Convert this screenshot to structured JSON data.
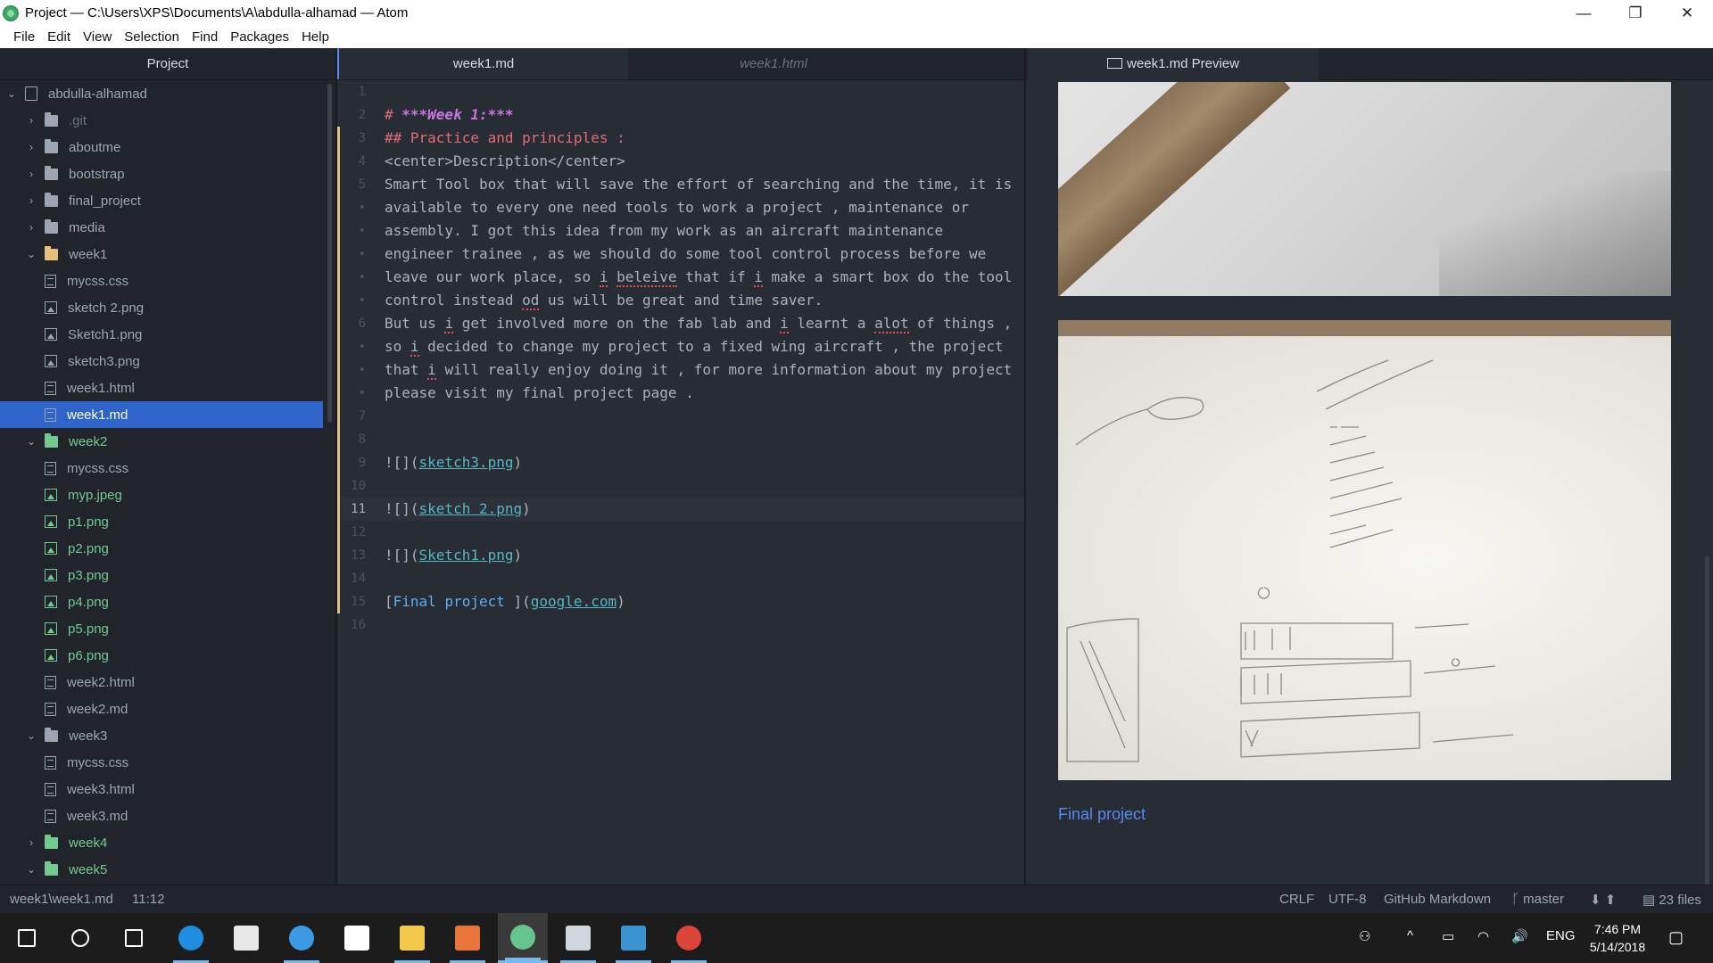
{
  "window": {
    "title": "Project — C:\\Users\\XPS\\Documents\\A\\abdulla-alhamad — Atom",
    "controls": {
      "minimize": "—",
      "maximize": "❐",
      "close": "✕"
    }
  },
  "menu": [
    "File",
    "Edit",
    "View",
    "Selection",
    "Find",
    "Packages",
    "Help"
  ],
  "tree": {
    "header": "Project",
    "rows": [
      {
        "label": "abdulla-alhamad",
        "arrow": "⌄",
        "icon": "repo",
        "indent": 0,
        "color": ""
      },
      {
        "label": ".git",
        "arrow": "›",
        "icon": "folder",
        "indent": 1,
        "color": "git"
      },
      {
        "label": "aboutme",
        "arrow": "›",
        "icon": "folder",
        "indent": 1,
        "color": ""
      },
      {
        "label": "bootstrap",
        "arrow": "›",
        "icon": "folder",
        "indent": 1,
        "color": ""
      },
      {
        "label": "final_project",
        "arrow": "›",
        "icon": "folder",
        "indent": 1,
        "color": ""
      },
      {
        "label": "media",
        "arrow": "›",
        "icon": "folder",
        "indent": 1,
        "color": ""
      },
      {
        "label": "week1",
        "arrow": "⌄",
        "icon": "folder-open",
        "indent": 1,
        "color": ""
      },
      {
        "label": "mycss.css",
        "arrow": "",
        "icon": "file",
        "indent": 2,
        "color": ""
      },
      {
        "label": "sketch 2.png",
        "arrow": "",
        "icon": "media",
        "indent": 2,
        "color": ""
      },
      {
        "label": "Sketch1.png",
        "arrow": "",
        "icon": "media",
        "indent": 2,
        "color": ""
      },
      {
        "label": "sketch3.png",
        "arrow": "",
        "icon": "media",
        "indent": 2,
        "color": ""
      },
      {
        "label": "week1.html",
        "arrow": "",
        "icon": "file",
        "indent": 2,
        "color": ""
      },
      {
        "label": "week1.md",
        "arrow": "",
        "icon": "file",
        "indent": 2,
        "color": "",
        "selected": true
      },
      {
        "label": "week2",
        "arrow": "⌄",
        "icon": "folder-green",
        "indent": 1,
        "color": "green"
      },
      {
        "label": "mycss.css",
        "arrow": "",
        "icon": "file",
        "indent": 2,
        "color": ""
      },
      {
        "label": "myp.jpeg",
        "arrow": "",
        "icon": "media-green",
        "indent": 2,
        "color": "green"
      },
      {
        "label": "p1.png",
        "arrow": "",
        "icon": "media-green",
        "indent": 2,
        "color": "green"
      },
      {
        "label": "p2.png",
        "arrow": "",
        "icon": "media-green",
        "indent": 2,
        "color": "green"
      },
      {
        "label": "p3.png",
        "arrow": "",
        "icon": "media-green",
        "indent": 2,
        "color": "green"
      },
      {
        "label": "p4.png",
        "arrow": "",
        "icon": "media-green",
        "indent": 2,
        "color": "green"
      },
      {
        "label": "p5.png",
        "arrow": "",
        "icon": "media-green",
        "indent": 2,
        "color": "green"
      },
      {
        "label": "p6.png",
        "arrow": "",
        "icon": "media-green",
        "indent": 2,
        "color": "green"
      },
      {
        "label": "week2.html",
        "arrow": "",
        "icon": "file",
        "indent": 2,
        "color": ""
      },
      {
        "label": "week2.md",
        "arrow": "",
        "icon": "file",
        "indent": 2,
        "color": ""
      },
      {
        "label": "week3",
        "arrow": "⌄",
        "icon": "folder",
        "indent": 1,
        "color": ""
      },
      {
        "label": "mycss.css",
        "arrow": "",
        "icon": "file",
        "indent": 2,
        "color": ""
      },
      {
        "label": "week3.html",
        "arrow": "",
        "icon": "file",
        "indent": 2,
        "color": ""
      },
      {
        "label": "week3.md",
        "arrow": "",
        "icon": "file",
        "indent": 2,
        "color": ""
      },
      {
        "label": "week4",
        "arrow": "›",
        "icon": "folder-green",
        "indent": 1,
        "color": "green"
      },
      {
        "label": "week5",
        "arrow": "⌄",
        "icon": "folder-green",
        "indent": 1,
        "color": "green"
      }
    ]
  },
  "editor": {
    "tabs": [
      "week1.md",
      "week1.html"
    ],
    "cursor_line": 11,
    "lines": [
      {
        "n": "1",
        "segs": []
      },
      {
        "n": "2",
        "segs": [
          {
            "t": "# ",
            "c": "md-h"
          },
          {
            "t": "***Week 1:***",
            "c": "md-em"
          }
        ]
      },
      {
        "n": "3",
        "segs": [
          {
            "t": "## Practice and principles :",
            "c": "md-h"
          }
        ]
      },
      {
        "n": "4",
        "segs": [
          {
            "t": "<center>Description</center>",
            "c": ""
          }
        ]
      },
      {
        "n": "5",
        "segs": [
          {
            "t": "Smart Tool box that will save the effort of searching and the time, it is",
            "c": ""
          }
        ]
      },
      {
        "n": "•",
        "segs": [
          {
            "t": "available to every one need tools to work a project , maintenance or",
            "c": ""
          }
        ]
      },
      {
        "n": "•",
        "segs": [
          {
            "t": "assembly. I got this idea from my work as an aircraft maintenance",
            "c": ""
          }
        ]
      },
      {
        "n": "•",
        "segs": [
          {
            "t": "engineer trainee , as we should do some tool control process before we",
            "c": ""
          }
        ]
      },
      {
        "n": "•",
        "segs": [
          {
            "t": "leave our work place, so ",
            "c": ""
          },
          {
            "t": "i",
            "c": "spell"
          },
          {
            "t": " ",
            "c": ""
          },
          {
            "t": "beleive",
            "c": "spell"
          },
          {
            "t": " that if ",
            "c": ""
          },
          {
            "t": "i",
            "c": "spell"
          },
          {
            "t": " make a smart box do the tool",
            "c": ""
          }
        ]
      },
      {
        "n": "•",
        "segs": [
          {
            "t": "control instead ",
            "c": ""
          },
          {
            "t": "od",
            "c": "spell"
          },
          {
            "t": " us will be great and time saver.",
            "c": ""
          }
        ]
      },
      {
        "n": "6",
        "segs": [
          {
            "t": "But us ",
            "c": ""
          },
          {
            "t": "i",
            "c": "spell"
          },
          {
            "t": " get involved more on the fab lab and ",
            "c": ""
          },
          {
            "t": "i",
            "c": "spell"
          },
          {
            "t": " learnt a ",
            "c": ""
          },
          {
            "t": "alot",
            "c": "spell"
          },
          {
            "t": " of things ,",
            "c": ""
          }
        ]
      },
      {
        "n": "•",
        "segs": [
          {
            "t": "so ",
            "c": ""
          },
          {
            "t": "i",
            "c": "spell"
          },
          {
            "t": " decided to change my project to a fixed wing aircraft , the project",
            "c": ""
          }
        ]
      },
      {
        "n": "•",
        "segs": [
          {
            "t": "that ",
            "c": ""
          },
          {
            "t": "i",
            "c": "spell"
          },
          {
            "t": " will really enjoy doing it , for more information about my project",
            "c": ""
          }
        ]
      },
      {
        "n": "•",
        "segs": [
          {
            "t": "please visit my final project page .",
            "c": ""
          }
        ]
      },
      {
        "n": "7",
        "segs": []
      },
      {
        "n": "8",
        "segs": []
      },
      {
        "n": "9",
        "segs": [
          {
            "t": "![](",
            "c": ""
          },
          {
            "t": "sketch3.png",
            "c": "md-link"
          },
          {
            "t": ")",
            "c": ""
          }
        ]
      },
      {
        "n": "10",
        "segs": []
      },
      {
        "n": "11",
        "segs": [
          {
            "t": "![](",
            "c": ""
          },
          {
            "t": "sketch 2.png",
            "c": "md-link"
          },
          {
            "t": ")",
            "c": ""
          }
        ]
      },
      {
        "n": "12",
        "segs": []
      },
      {
        "n": "13",
        "segs": [
          {
            "t": "![](",
            "c": ""
          },
          {
            "t": "Sketch1.png",
            "c": "md-link"
          },
          {
            "t": ")",
            "c": ""
          }
        ]
      },
      {
        "n": "14",
        "segs": []
      },
      {
        "n": "15",
        "segs": [
          {
            "t": "[",
            "c": ""
          },
          {
            "t": "Final project ",
            "c": "md-text-link"
          },
          {
            "t": "](",
            "c": ""
          },
          {
            "t": "google.com",
            "c": "md-link"
          },
          {
            "t": ")",
            "c": ""
          }
        ]
      },
      {
        "n": "16",
        "segs": []
      }
    ]
  },
  "preview": {
    "tab": "week1.md Preview",
    "tab_icon": "markdown-icon",
    "link_text": "Final project",
    "images": [
      "sketch3.png",
      "sketch 2.png"
    ]
  },
  "status": {
    "path": "week1\\week1.md",
    "position": "11:12",
    "line_ending": "CRLF",
    "encoding": "UTF-8",
    "grammar": "GitHub Markdown",
    "branch": "master",
    "files": "23 files"
  },
  "taskbar": {
    "language": "ENG",
    "time": "7:46 PM",
    "date": "5/14/2018",
    "apps": [
      {
        "name": "start-icon",
        "color": "#ffffff"
      },
      {
        "name": "search-icon",
        "color": "#ffffff"
      },
      {
        "name": "task-view-icon",
        "color": "#ffffff"
      },
      {
        "name": "edge-icon",
        "color": "#1f8ee0"
      },
      {
        "name": "store-icon",
        "color": "#e8e8e8"
      },
      {
        "name": "safari-icon",
        "color": "#3a9ae3"
      },
      {
        "name": "mail-icon",
        "color": "#ffffff"
      },
      {
        "name": "explorer-icon",
        "color": "#f4c84a"
      },
      {
        "name": "git-icon",
        "color": "#e8743b"
      },
      {
        "name": "atom-icon",
        "color": "#66c58d"
      },
      {
        "name": "paint-icon",
        "color": "#cfd8dc"
      },
      {
        "name": "fusion-icon",
        "color": "#3b94d0"
      },
      {
        "name": "chrome-icon",
        "color": "#db4437"
      }
    ]
  }
}
